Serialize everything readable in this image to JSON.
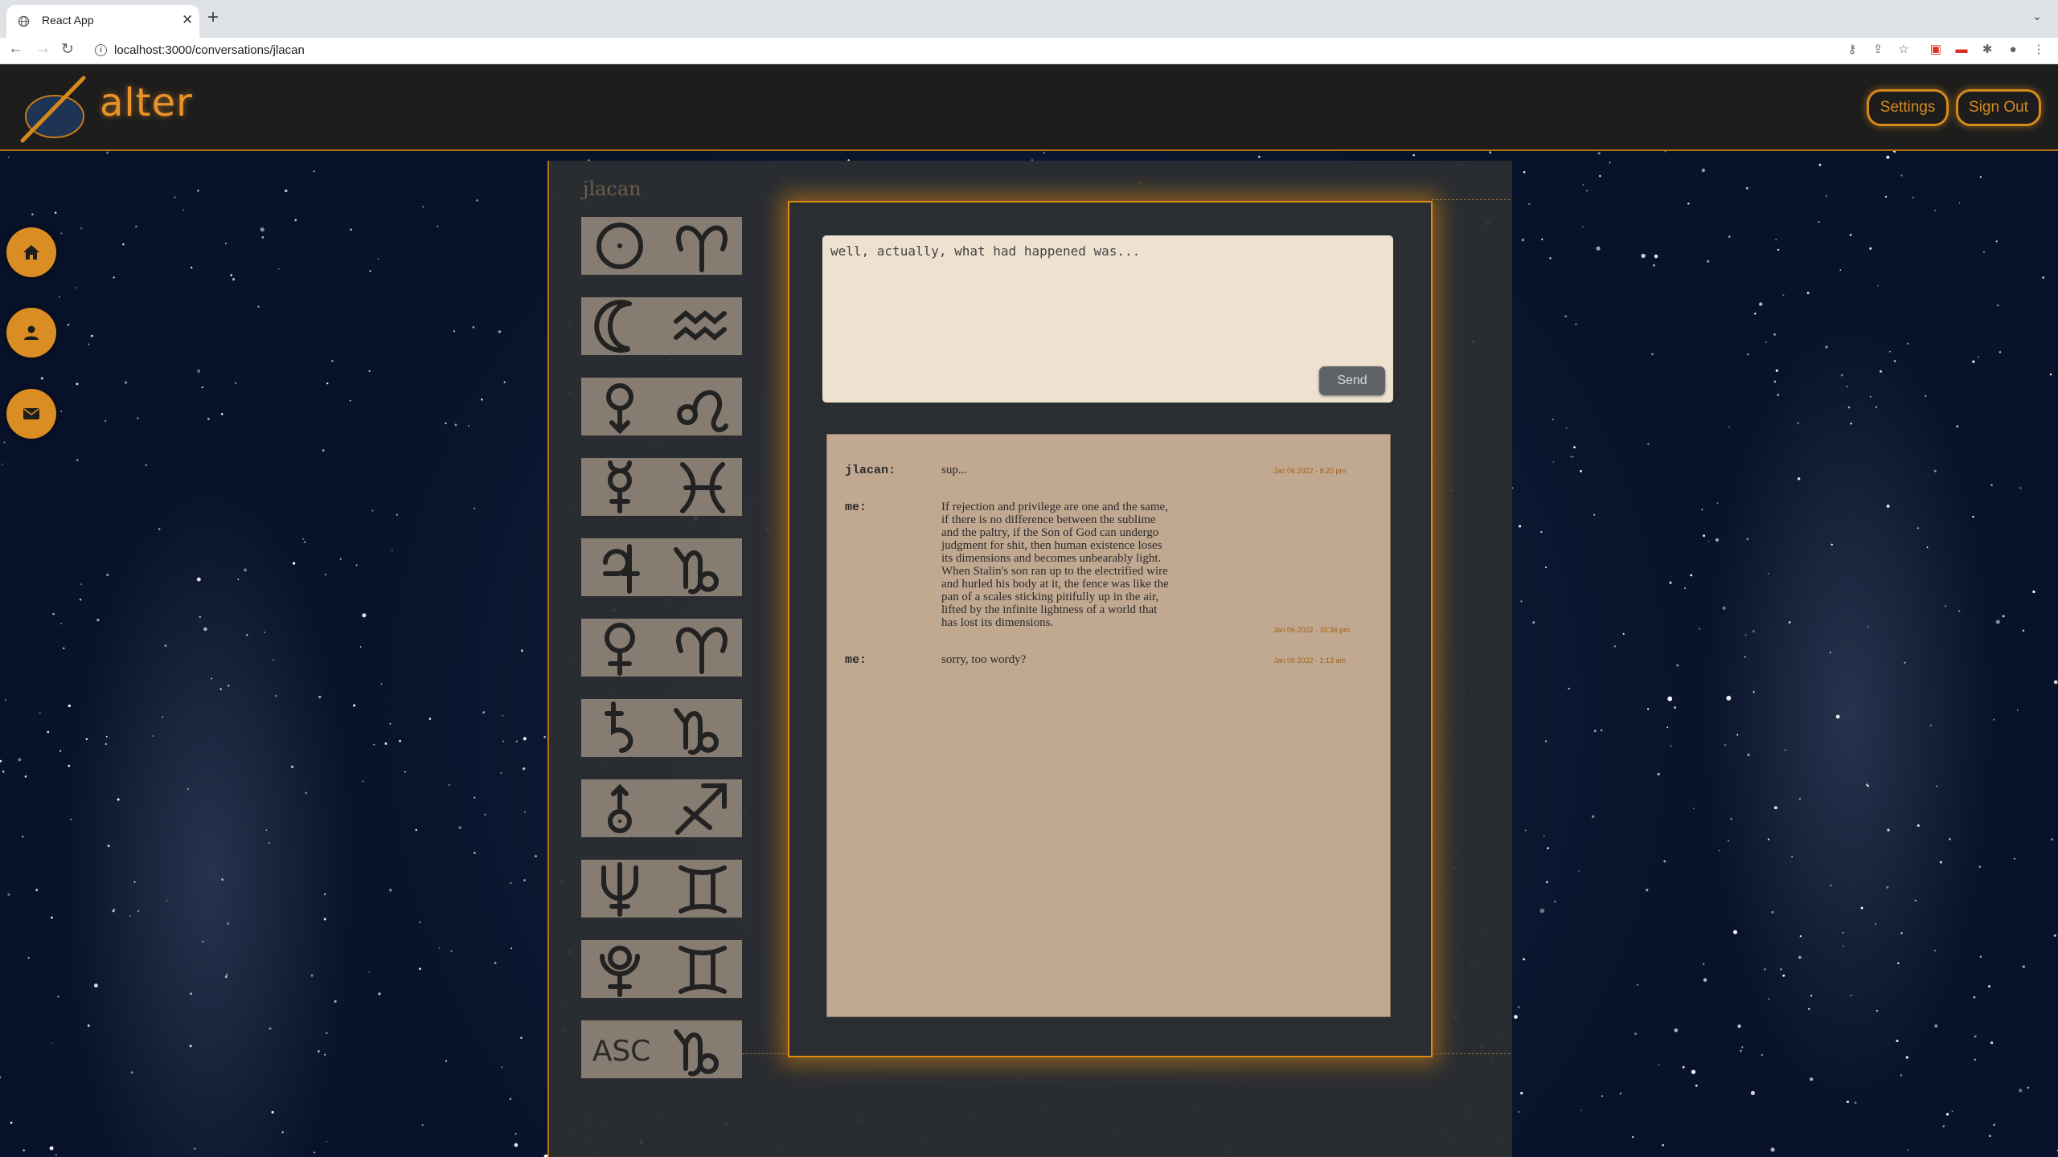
{
  "browser": {
    "tab_title": "React App",
    "url": "localhost:3000/conversations/jlacan"
  },
  "app": {
    "logo_text": "alter",
    "settings_label": "Settings",
    "signout_label": "Sign Out",
    "accent_color": "#d98d22"
  },
  "sidenav": {
    "items": [
      {
        "name": "home",
        "icon": "home-icon"
      },
      {
        "name": "profile",
        "icon": "person-icon"
      },
      {
        "name": "messages",
        "icon": "mail-icon"
      }
    ]
  },
  "conversation": {
    "partner": "jlacan",
    "chart_glyphs": [
      {
        "planet": "sun-icon",
        "sign": "aries-icon"
      },
      {
        "planet": "moon-icon",
        "sign": "aquarius-icon"
      },
      {
        "planet": "mars-icon",
        "sign": "leo-icon"
      },
      {
        "planet": "mercury-icon",
        "sign": "pisces-icon"
      },
      {
        "planet": "jupiter-icon",
        "sign": "capricorn-icon"
      },
      {
        "planet": "venus-icon",
        "sign": "aries-icon"
      },
      {
        "planet": "saturn-icon",
        "sign": "capricorn-icon"
      },
      {
        "planet": "uranus-icon",
        "sign": "sagittarius-icon"
      },
      {
        "planet": "neptune-icon",
        "sign": "gemini-icon"
      },
      {
        "planet": "pluto-icon",
        "sign": "gemini-icon"
      },
      {
        "planet": "ASC",
        "sign": "capricorn-icon"
      }
    ],
    "compose_text": "well, actually, what had happened was...",
    "send_label": "Send",
    "messages": [
      {
        "sender": "jlacan:",
        "text": "sup...",
        "timestamp": "Jan 06 2022 - 9:20 pm"
      },
      {
        "sender": "me:",
        "text": "If rejection and privilege are one and the same,\nif there is no difference between the sublime\nand the paltry, if the Son of God can undergo\njudgment for shit, then human existence loses\nits dimensions and becomes unbearably light.\nWhen Stalin's son ran up to the electrified wire\nand hurled his body at it, the fence was like the\npan of a scales sticking pitifully up in the air,\nlifted by the infinite lightness of a world that\nhas lost its dimensions.",
        "timestamp": "Jan 06 2022 - 10:36 pm"
      },
      {
        "sender": "me:",
        "text": "sorry, too wordy?",
        "timestamp": "Jan 06 2022 - 1:13 am"
      }
    ]
  }
}
